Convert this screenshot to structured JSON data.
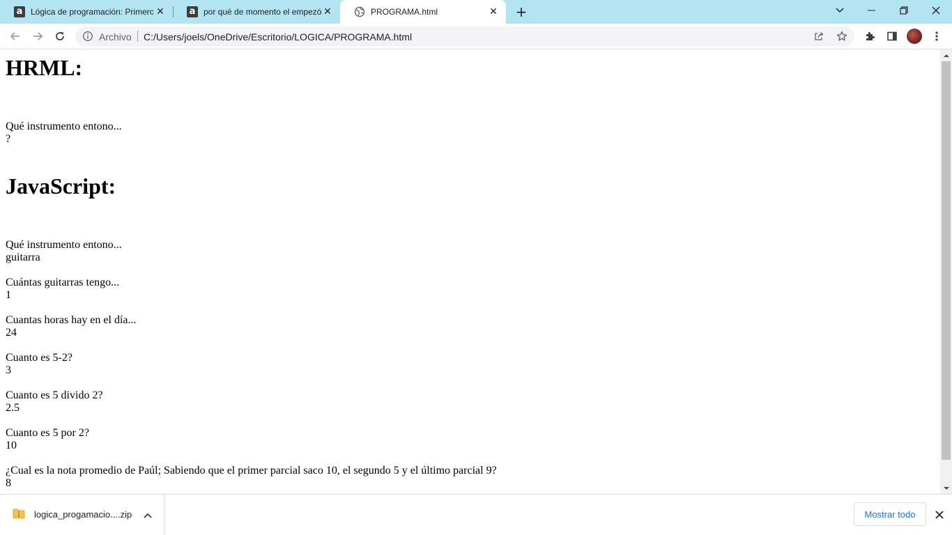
{
  "tabs": [
    {
      "title": "Lógica de programación: Primeros pasos",
      "favicon": "alura-icon",
      "active": false
    },
    {
      "title": "por qué de momento el empezó",
      "favicon": "alura-icon",
      "active": false
    },
    {
      "title": "PROGRAMA.html",
      "favicon": "globe-icon",
      "active": true
    }
  ],
  "tab_favicon_letter": "a",
  "tab_close_glyph": "✕",
  "new_tab_glyph": "+",
  "omnibox": {
    "scheme_label": "Archivo",
    "url": "C:/Users/joels/OneDrive/Escritorio/LOGICA/PROGRAMA.html"
  },
  "page": {
    "heading_html": "HRML:",
    "html_question": "Qué instrumento entono...",
    "html_answer": "?",
    "heading_js": "JavaScript:",
    "js_items": [
      {
        "q": "Qué instrumento entono...",
        "a": "guitarra"
      },
      {
        "q": "Cuántas guitarras tengo...",
        "a": "1"
      },
      {
        "q": "Cuantas horas hay en el día...",
        "a": "24"
      },
      {
        "q": "Cuanto es 5-2?",
        "a": "3"
      },
      {
        "q": "Cuanto es 5 divido 2?",
        "a": "2.5"
      },
      {
        "q": "Cuanto es 5 por 2?",
        "a": "10"
      },
      {
        "q": "¿Cual es la nota promedio de Paúl; Sabiendo que el primer parcial saco 10, el segundo 5 y el último parcial 9?",
        "a": "8"
      }
    ]
  },
  "download_bar": {
    "file_name": "logica_progamacio....zip",
    "show_all_label": "Mostrar todo"
  },
  "colors": {
    "tabstrip_bg": "#b3e4f2",
    "link_blue": "#1a73e8",
    "omnibox_bg": "#f1f3f4"
  }
}
